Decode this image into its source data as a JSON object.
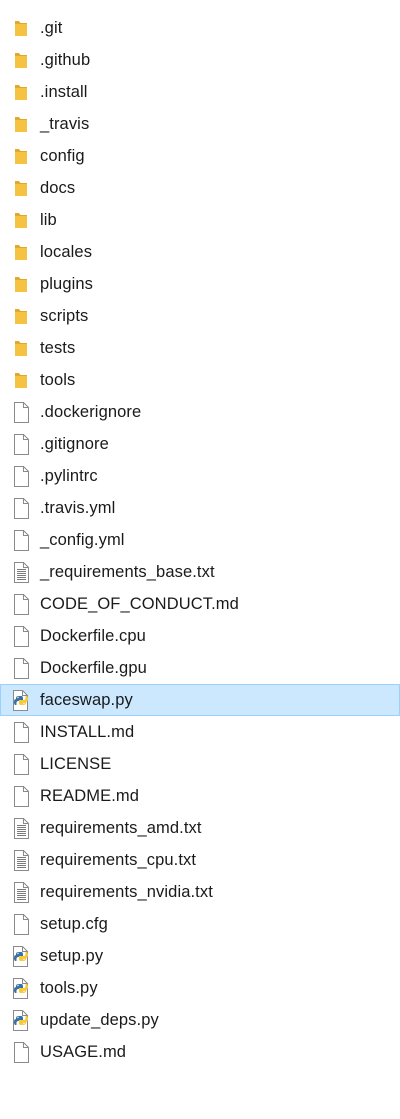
{
  "explorer": {
    "items": [
      {
        "name": ".git",
        "icon": "folder-icon",
        "selected": false
      },
      {
        "name": ".github",
        "icon": "folder-icon",
        "selected": false
      },
      {
        "name": ".install",
        "icon": "folder-icon",
        "selected": false
      },
      {
        "name": "_travis",
        "icon": "folder-icon",
        "selected": false
      },
      {
        "name": "config",
        "icon": "folder-icon",
        "selected": false
      },
      {
        "name": "docs",
        "icon": "folder-icon",
        "selected": false
      },
      {
        "name": "lib",
        "icon": "folder-icon",
        "selected": false
      },
      {
        "name": "locales",
        "icon": "folder-icon",
        "selected": false
      },
      {
        "name": "plugins",
        "icon": "folder-icon",
        "selected": false
      },
      {
        "name": "scripts",
        "icon": "folder-icon",
        "selected": false
      },
      {
        "name": "tests",
        "icon": "folder-icon",
        "selected": false
      },
      {
        "name": "tools",
        "icon": "folder-icon",
        "selected": false
      },
      {
        "name": ".dockerignore",
        "icon": "file-icon",
        "selected": false
      },
      {
        "name": ".gitignore",
        "icon": "file-icon",
        "selected": false
      },
      {
        "name": ".pylintrc",
        "icon": "file-icon",
        "selected": false
      },
      {
        "name": ".travis.yml",
        "icon": "file-icon",
        "selected": false
      },
      {
        "name": "_config.yml",
        "icon": "file-icon",
        "selected": false
      },
      {
        "name": "_requirements_base.txt",
        "icon": "text-file-icon",
        "selected": false
      },
      {
        "name": "CODE_OF_CONDUCT.md",
        "icon": "file-icon",
        "selected": false
      },
      {
        "name": "Dockerfile.cpu",
        "icon": "file-icon",
        "selected": false
      },
      {
        "name": "Dockerfile.gpu",
        "icon": "file-icon",
        "selected": false
      },
      {
        "name": "faceswap.py",
        "icon": "python-file-icon",
        "selected": true
      },
      {
        "name": "INSTALL.md",
        "icon": "file-icon",
        "selected": false
      },
      {
        "name": "LICENSE",
        "icon": "file-icon",
        "selected": false
      },
      {
        "name": "README.md",
        "icon": "file-icon",
        "selected": false
      },
      {
        "name": "requirements_amd.txt",
        "icon": "text-file-icon",
        "selected": false
      },
      {
        "name": "requirements_cpu.txt",
        "icon": "text-file-icon",
        "selected": false
      },
      {
        "name": "requirements_nvidia.txt",
        "icon": "text-file-icon",
        "selected": false
      },
      {
        "name": "setup.cfg",
        "icon": "file-icon",
        "selected": false
      },
      {
        "name": "setup.py",
        "icon": "python-file-icon",
        "selected": false
      },
      {
        "name": "tools.py",
        "icon": "python-file-icon",
        "selected": false
      },
      {
        "name": "update_deps.py",
        "icon": "python-file-icon",
        "selected": false
      },
      {
        "name": "USAGE.md",
        "icon": "file-icon",
        "selected": false
      }
    ]
  },
  "colors": {
    "folder": "#f5c342",
    "folder_dark": "#e0a82e",
    "selection_bg": "#cce8ff",
    "selection_border": "#99d1ff",
    "python_blue": "#3772a4",
    "python_yellow": "#f6c93d"
  }
}
